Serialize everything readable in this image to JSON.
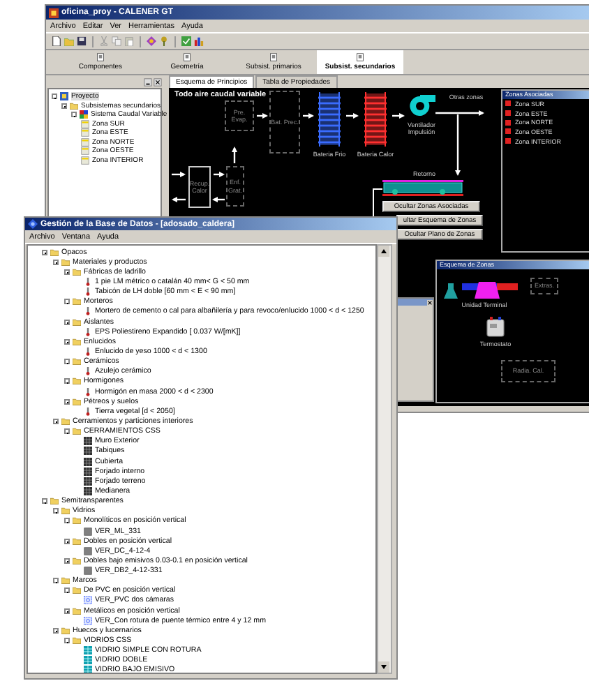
{
  "main_window": {
    "title": "oficina_proy - CALENER GT",
    "menu": [
      "Archivo",
      "Editar",
      "Ver",
      "Herramientas",
      "Ayuda"
    ],
    "module_tabs": [
      {
        "label": "Componentes",
        "selected": false
      },
      {
        "label": "Geometría",
        "selected": false
      },
      {
        "label": "Subsist. primarios",
        "selected": false
      },
      {
        "label": "Subsist. secundarios",
        "selected": true
      }
    ],
    "project_tree": [
      {
        "label": "Proyecto",
        "kind": "project",
        "selected": true,
        "expanded": true,
        "children": [
          {
            "label": "Subsistemas secundarios",
            "kind": "folder",
            "selected": false,
            "expanded": true,
            "children": [
              {
                "label": "Sistema Caudal Variable",
                "kind": "system",
                "selected": false,
                "expanded": true,
                "children": [
                  {
                    "label": "Zona SUR",
                    "kind": "zone",
                    "selected": false
                  },
                  {
                    "label": "Zona ESTE",
                    "kind": "zone",
                    "selected": false
                  },
                  {
                    "label": "Zona NORTE",
                    "kind": "zone",
                    "selected": false
                  },
                  {
                    "label": "Zona OESTE",
                    "kind": "zone",
                    "selected": false
                  },
                  {
                    "label": "Zona INTERIOR",
                    "kind": "zone",
                    "selected": false
                  }
                ]
              }
            ]
          }
        ]
      }
    ],
    "view_tabs": [
      {
        "label": "Esquema de Principios",
        "selected": true
      },
      {
        "label": "Tabla de Propiedades",
        "selected": false
      }
    ],
    "diagram": {
      "title": "Todo aire caudal variable",
      "nodes": [
        {
          "kind": "pre_evaporative",
          "label": "Pre. Evap."
        },
        {
          "kind": "pre_heating",
          "label": "Bat. Prec."
        },
        {
          "kind": "cooling_coil",
          "label": "Bateria Frio"
        },
        {
          "kind": "heating_coil",
          "label": "Bateria Calor"
        },
        {
          "kind": "fan",
          "label": "Ventilador Impulsión"
        },
        {
          "kind": "outlet",
          "label": "Otras zonas"
        },
        {
          "kind": "return_duct",
          "label": "Retorno"
        },
        {
          "kind": "heat_recovery",
          "label": "Recup. Calor"
        },
        {
          "kind": "free_cooling",
          "label": "Enf. Grat."
        }
      ],
      "buttons": [
        "Ocultar Zonas Asociadas",
        "ultar Esquema de Zonas",
        "Ocultar Plano de Zonas"
      ],
      "zones_panel": {
        "title": "Zonas Asociadas",
        "zones": [
          {
            "label": "Zona SUR",
            "checked": true
          },
          {
            "label": "Zona ESTE",
            "checked": true
          },
          {
            "label": "Zona NORTE",
            "checked": true
          },
          {
            "label": "Zona OESTE",
            "checked": true
          },
          {
            "label": "Zona INTERIOR",
            "checked": true
          }
        ]
      },
      "zone_scheme": {
        "title": "Esquema de Zonas",
        "nodes": [
          {
            "kind": "terminal_unit",
            "label": "Unidad Terminal"
          },
          {
            "kind": "extras",
            "label": "Extras."
          },
          {
            "kind": "thermostat",
            "label": "Termostato"
          },
          {
            "kind": "radiator",
            "label": "Radia. Cal."
          }
        ]
      }
    }
  },
  "database_window": {
    "title": "Gestión de la Base de Datos - [adosado_caldera]",
    "menu": [
      "Archivo",
      "Ventana",
      "Ayuda"
    ],
    "tree": [
      {
        "label": "Opacos",
        "kind": "folder",
        "expanded": true,
        "children": [
          {
            "label": "Materiales y productos",
            "kind": "folder",
            "expanded": true,
            "children": [
              {
                "label": "Fábricas de ladrillo",
                "kind": "folder",
                "expanded": true,
                "children": [
                  {
                    "label": "1 pie LM métrico o catalán 40 mm< G < 50 mm",
                    "kind": "material"
                  },
                  {
                    "label": "Tabicón de LH doble [60 mm < E < 90 mm]",
                    "kind": "material"
                  }
                ]
              },
              {
                "label": "Morteros",
                "kind": "folder",
                "expanded": true,
                "children": [
                  {
                    "label": "Mortero de cemento o cal para albañilería y para revoco/enlucido 1000 < d < 1250",
                    "kind": "material"
                  }
                ]
              },
              {
                "label": "Aislantes",
                "kind": "folder",
                "expanded": true,
                "children": [
                  {
                    "label": "EPS Poliestireno Expandido [ 0.037 W/[mK]]",
                    "kind": "material"
                  }
                ]
              },
              {
                "label": "Enlucidos",
                "kind": "folder",
                "expanded": true,
                "children": [
                  {
                    "label": "Enlucido de yeso 1000 < d < 1300",
                    "kind": "material"
                  }
                ]
              },
              {
                "label": "Cerámicos",
                "kind": "folder",
                "expanded": true,
                "children": [
                  {
                    "label": "Azulejo cerámico",
                    "kind": "material"
                  }
                ]
              },
              {
                "label": "Hormigones",
                "kind": "folder",
                "expanded": true,
                "children": [
                  {
                    "label": "Hormigón en masa 2000 < d < 2300",
                    "kind": "material"
                  }
                ]
              },
              {
                "label": "Pétreos y suelos",
                "kind": "folder",
                "expanded": true,
                "children": [
                  {
                    "label": "Tierra vegetal [d < 2050]",
                    "kind": "material"
                  }
                ]
              }
            ]
          },
          {
            "label": "Cerramientos y particiones interiores",
            "kind": "folder",
            "expanded": true,
            "children": [
              {
                "label": "CERRAMIENTOS CSS",
                "kind": "folder",
                "expanded": true,
                "children": [
                  {
                    "label": "Muro Exterior",
                    "kind": "construction"
                  },
                  {
                    "label": "Tabiques",
                    "kind": "construction"
                  },
                  {
                    "label": "Cubierta",
                    "kind": "construction"
                  },
                  {
                    "label": "Forjado interno",
                    "kind": "construction"
                  },
                  {
                    "label": "Forjado terreno",
                    "kind": "construction"
                  },
                  {
                    "label": "Medianera",
                    "kind": "construction"
                  }
                ]
              }
            ]
          }
        ]
      },
      {
        "label": "Semitransparentes",
        "kind": "folder",
        "expanded": true,
        "children": [
          {
            "label": "Vidrios",
            "kind": "folder",
            "expanded": true,
            "children": [
              {
                "label": "Monolíticos en posición vertical",
                "kind": "folder",
                "expanded": true,
                "children": [
                  {
                    "label": "VER_ML_331",
                    "kind": "glass"
                  }
                ]
              },
              {
                "label": "Dobles en posición vertical",
                "kind": "folder",
                "expanded": true,
                "children": [
                  {
                    "label": "VER_DC_4-12-4",
                    "kind": "glass"
                  }
                ]
              },
              {
                "label": "Dobles bajo emisivos 0.03-0.1 en posición vertical",
                "kind": "folder",
                "expanded": true,
                "children": [
                  {
                    "label": "VER_DB2_4-12-331",
                    "kind": "glass"
                  }
                ]
              }
            ]
          },
          {
            "label": "Marcos",
            "kind": "folder",
            "expanded": true,
            "children": [
              {
                "label": "De PVC en posición vertical",
                "kind": "folder",
                "expanded": true,
                "children": [
                  {
                    "label": "VER_PVC dos cámaras",
                    "kind": "frame"
                  }
                ]
              },
              {
                "label": "Metálicos en posición vertical",
                "kind": "folder",
                "expanded": true,
                "children": [
                  {
                    "label": "VER_Con rotura de puente térmico entre 4 y 12 mm",
                    "kind": "frame"
                  }
                ]
              }
            ]
          },
          {
            "label": "Huecos y lucernarios",
            "kind": "folder",
            "expanded": true,
            "children": [
              {
                "label": "VIDRIOS CSS",
                "kind": "folder",
                "expanded": true,
                "children": [
                  {
                    "label": "VIDRIO SIMPLE CON ROTURA",
                    "kind": "glazing"
                  },
                  {
                    "label": "VIDRIO DOBLE",
                    "kind": "glazing"
                  },
                  {
                    "label": "VIDRIO BAJO EMISIVO",
                    "kind": "glazing"
                  }
                ]
              }
            ]
          }
        ]
      }
    ]
  }
}
